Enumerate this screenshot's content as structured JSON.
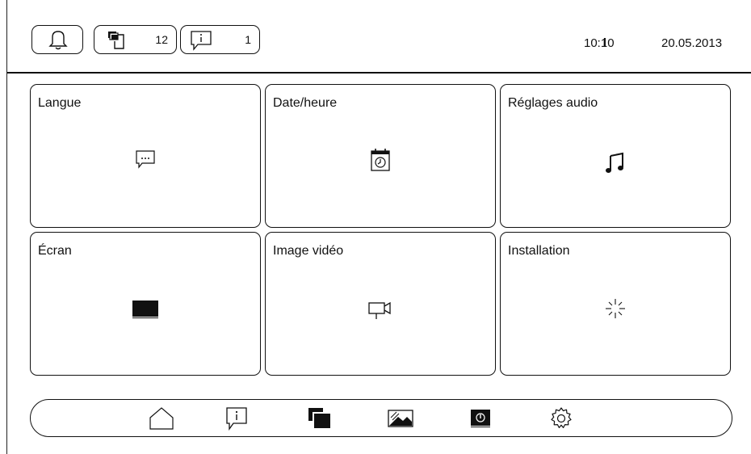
{
  "header": {
    "message_count": "12",
    "info_count": "1",
    "time": "10:10",
    "date": "20.05.2013"
  },
  "tiles": [
    {
      "label": "Langue",
      "icon": "speech-bubble-icon"
    },
    {
      "label": "Date/heure",
      "icon": "calendar-clock-icon"
    },
    {
      "label": "Réglages audio",
      "icon": "music-note-icon"
    },
    {
      "label": "Écran",
      "icon": "screen-icon"
    },
    {
      "label": "Image vidéo",
      "icon": "video-camera-icon"
    },
    {
      "label": "Installation",
      "icon": "sparkle-icon"
    }
  ],
  "nav": [
    "home-icon",
    "info-bubble-icon",
    "gallery-icon",
    "picture-icon",
    "power-panel-icon",
    "gear-icon"
  ]
}
